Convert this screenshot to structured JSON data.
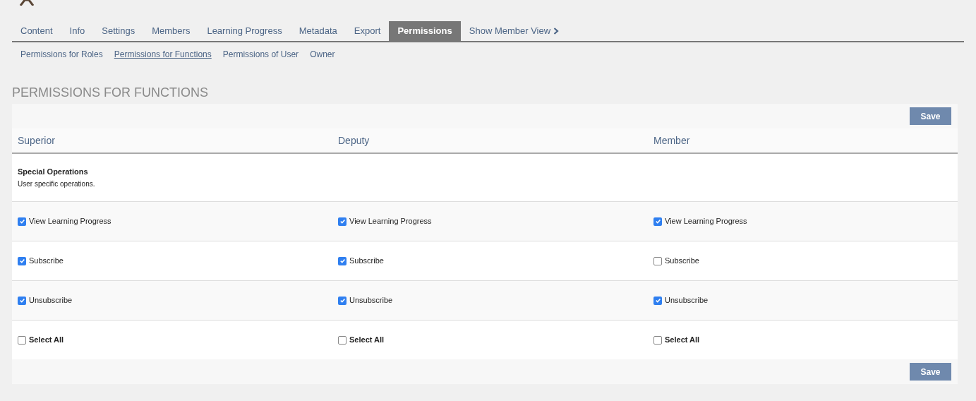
{
  "tabs": [
    {
      "label": "Content",
      "selected": false
    },
    {
      "label": "Info",
      "selected": false
    },
    {
      "label": "Settings",
      "selected": false
    },
    {
      "label": "Members",
      "selected": false
    },
    {
      "label": "Learning Progress",
      "selected": false
    },
    {
      "label": "Metadata",
      "selected": false
    },
    {
      "label": "Export",
      "selected": false
    },
    {
      "label": "Permissions",
      "selected": true
    },
    {
      "label": "Show Member View",
      "selected": false
    }
  ],
  "subtabs": [
    {
      "label": "Permissions for Roles",
      "selected": false
    },
    {
      "label": "Permissions for Functions",
      "selected": true
    },
    {
      "label": "Permissions of User",
      "selected": false
    },
    {
      "label": "Owner",
      "selected": false
    }
  ],
  "heading": "PERMISSIONS FOR FUNCTIONS",
  "save_button": "Save",
  "columns": [
    "Superior",
    "Deputy",
    "Member"
  ],
  "section": {
    "title": "Special Operations",
    "description": "User specific operations."
  },
  "rows": [
    {
      "cells": [
        {
          "label": "View Learning Progress",
          "checked": true
        },
        {
          "label": "View Learning Progress",
          "checked": true
        },
        {
          "label": "View Learning Progress",
          "checked": true
        }
      ]
    },
    {
      "cells": [
        {
          "label": "Subscribe",
          "checked": true
        },
        {
          "label": "Subscribe",
          "checked": true
        },
        {
          "label": "Subscribe",
          "checked": false
        }
      ]
    },
    {
      "cells": [
        {
          "label": "Unsubscribe",
          "checked": true
        },
        {
          "label": "Unsubscribe",
          "checked": true
        },
        {
          "label": "Unsubscribe",
          "checked": true
        }
      ]
    }
  ],
  "select_all": [
    {
      "label": "Select All",
      "checked": false
    },
    {
      "label": "Select All",
      "checked": false
    },
    {
      "label": "Select All",
      "checked": false
    }
  ],
  "bottom_save_button": "Save"
}
